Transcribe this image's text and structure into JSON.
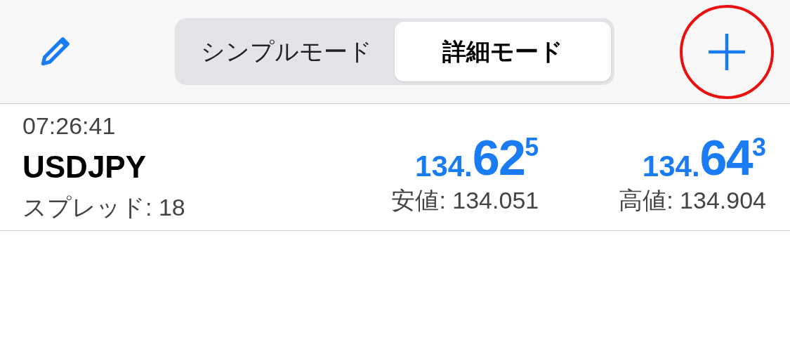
{
  "toolbar": {
    "segments": [
      {
        "label": "シンプルモード",
        "selected": false
      },
      {
        "label": "詳細モード",
        "selected": true
      }
    ]
  },
  "quotes": [
    {
      "time": "07:26:41",
      "symbol": "USDJPY",
      "spread": "スプレッド: 18",
      "bid": {
        "prefix": "134.",
        "big": "62",
        "small": "5"
      },
      "low": "安値: 134.051",
      "ask": {
        "prefix": "134.",
        "big": "64",
        "small": "3"
      },
      "high": "高値: 134.904"
    }
  ]
}
